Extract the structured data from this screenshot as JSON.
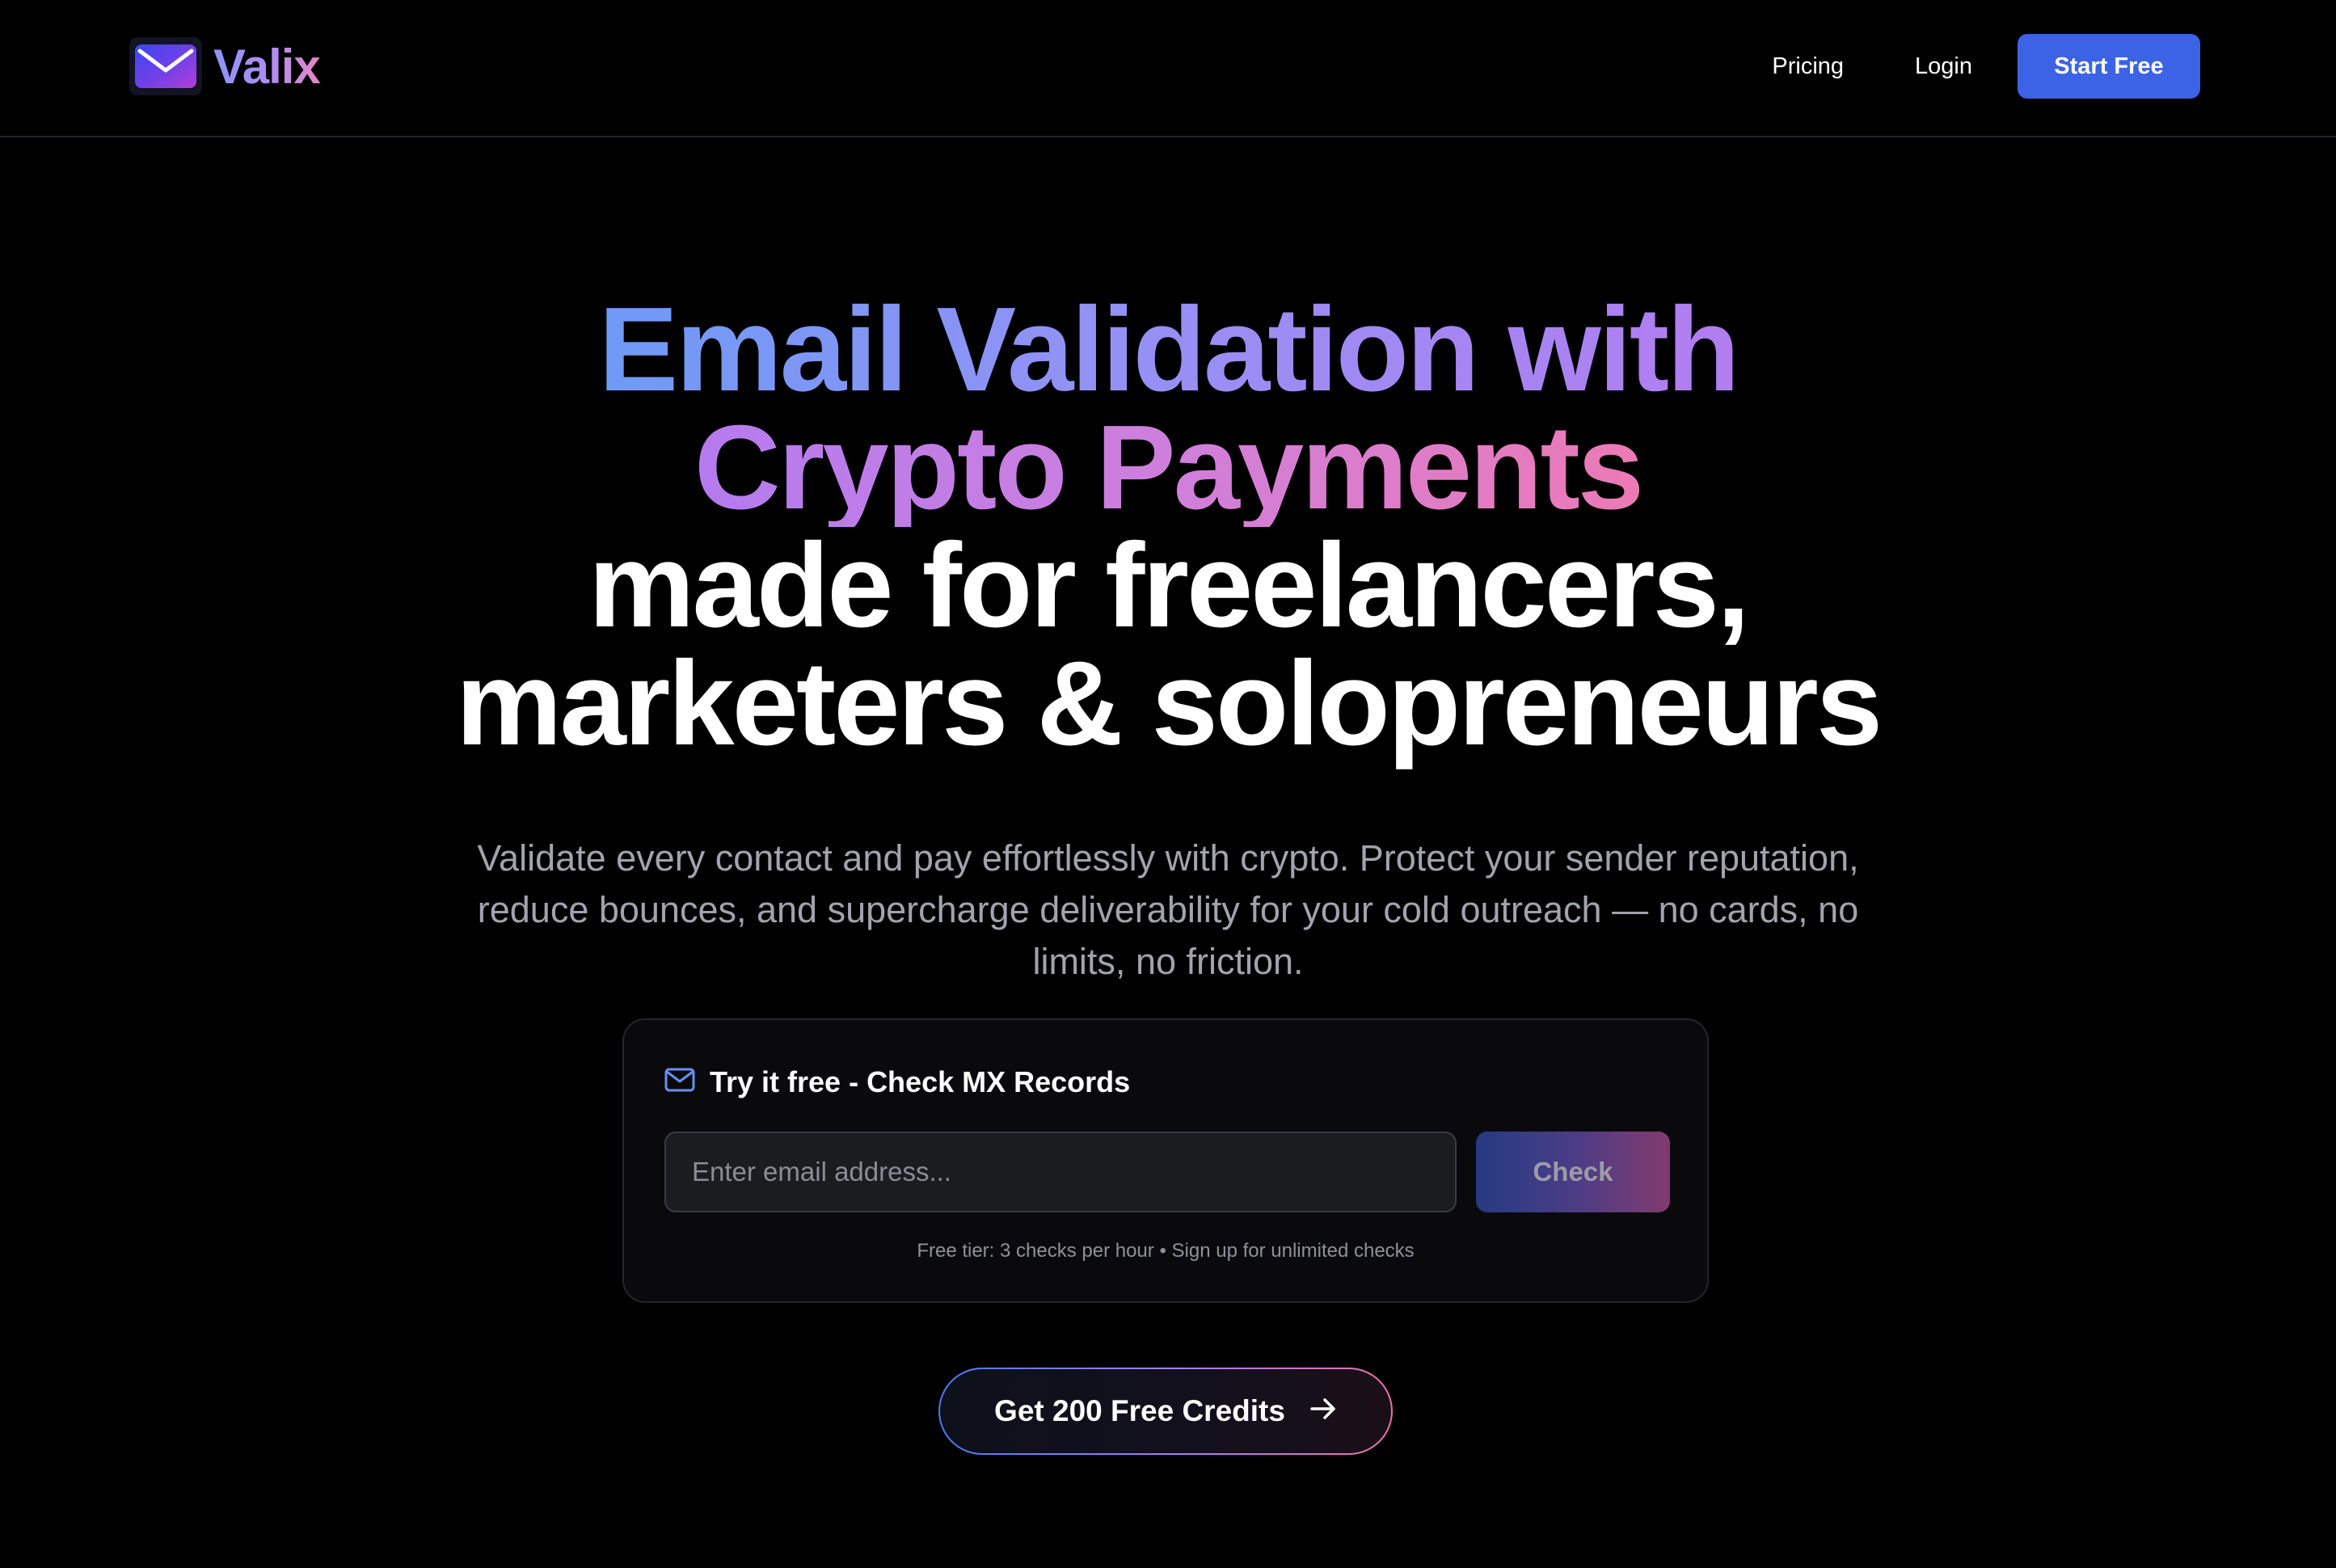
{
  "brand": {
    "name": "Valix",
    "logo_icon": "envelope-icon"
  },
  "nav": {
    "pricing_label": "Pricing",
    "login_label": "Login",
    "start_free_label": "Start Free"
  },
  "hero": {
    "line1": "Email Validation with",
    "line2": "Crypto Payments",
    "line3": "made for freelancers,",
    "line4": "marketers & solopreneurs",
    "subtitle": "Validate every contact and pay effortlessly with crypto. Protect your sender reputation, reduce bounces, and supercharge deliverability for your cold outreach — no cards, no limits, no friction."
  },
  "checker": {
    "title": "Try it free - Check MX Records",
    "title_icon": "mail-icon",
    "email_placeholder": "Enter email address...",
    "email_value": "",
    "check_label": "Check",
    "note": "Free tier: 3 checks per hour • Sign up for unlimited checks"
  },
  "cta": {
    "label": "Get 200 Free Credits",
    "icon": "arrow-right-icon"
  },
  "colors": {
    "background": "#000000",
    "primary_button": "#3c63e5",
    "gradient_blue": "#6e9af6",
    "gradient_purple": "#b27df0",
    "gradient_pink": "#ec7ab5",
    "muted_text": "#a1a4ad"
  }
}
